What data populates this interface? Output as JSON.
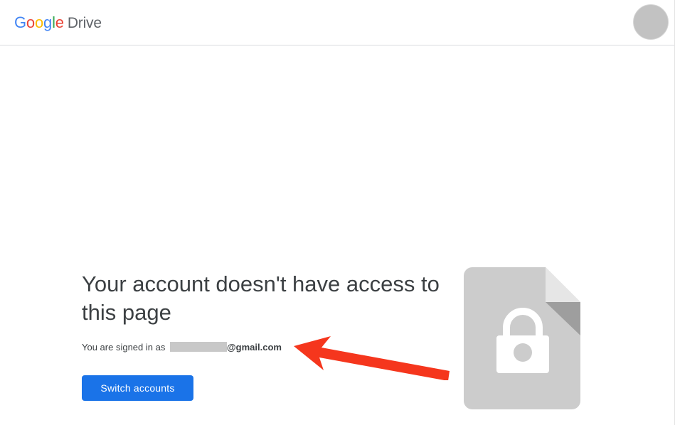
{
  "header": {
    "logo_letters": [
      {
        "char": "G",
        "color": "#4285F4"
      },
      {
        "char": "o",
        "color": "#EA4335"
      },
      {
        "char": "o",
        "color": "#FBBC05"
      },
      {
        "char": "g",
        "color": "#4285F4"
      },
      {
        "char": "l",
        "color": "#34A853"
      },
      {
        "char": "e",
        "color": "#EA4335"
      }
    ],
    "product_name": "Drive",
    "avatar_icon": "account-avatar"
  },
  "main": {
    "title": "Your account doesn't have access to this page",
    "signed_in_prefix": "You are signed in as",
    "email_domain": "@gmail.com",
    "switch_button_label": "Switch accounts",
    "illustration_icon": "locked-document-icon",
    "annotation_icon": "red-arrow-icon"
  },
  "colors": {
    "button": "#1a73e8",
    "arrow": "#f5361d",
    "doc_gray": "#cccccc"
  }
}
